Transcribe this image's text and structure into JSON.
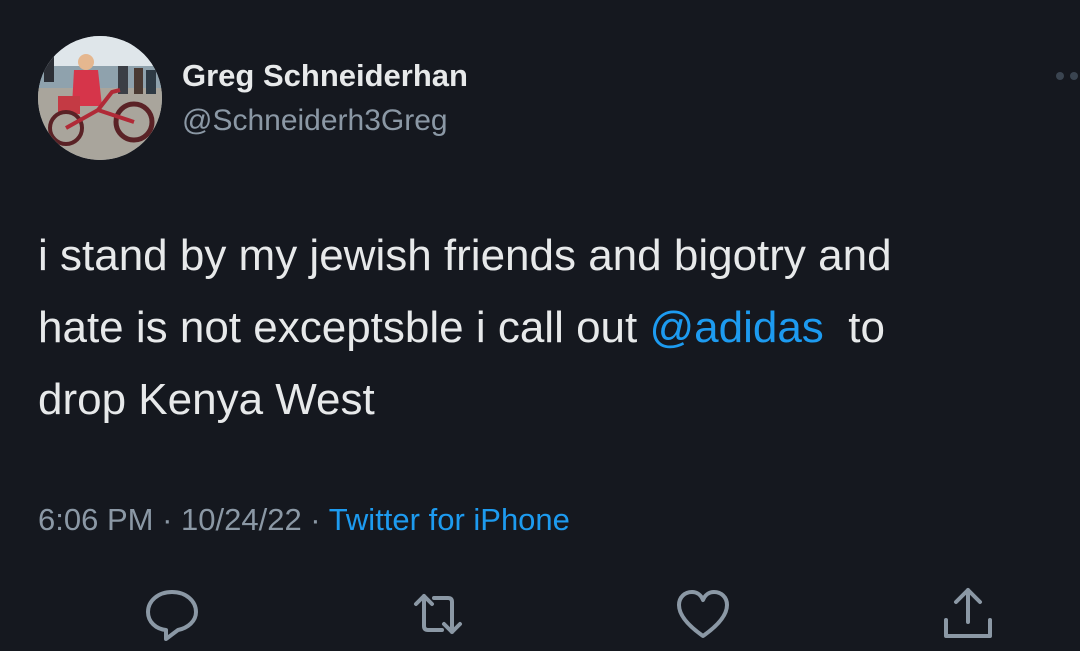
{
  "tweet": {
    "author": {
      "display_name": "Greg Schneiderhan",
      "handle": "@Schneiderh3Greg",
      "avatar_icon": "avatar-photo-tricycle"
    },
    "text": {
      "line1": "i stand by my jewish friends and bigotry and",
      "line2_before": "hate is not exceptsble i call out ",
      "line2_mention": "@adidas",
      "line2_after": "  to",
      "line3": "drop Kenya West"
    },
    "meta": {
      "time": "6:06 PM",
      "date": "10/24/22",
      "source": "Twitter for iPhone",
      "separator": " · "
    },
    "actions": [
      {
        "icon": "reply-icon"
      },
      {
        "icon": "retweet-icon"
      },
      {
        "icon": "like-icon"
      },
      {
        "icon": "share-icon"
      }
    ]
  },
  "colors": {
    "background": "#15181f",
    "text": "#e7e9ea",
    "secondary": "#8b98a5",
    "accent": "#1d9bf0"
  }
}
